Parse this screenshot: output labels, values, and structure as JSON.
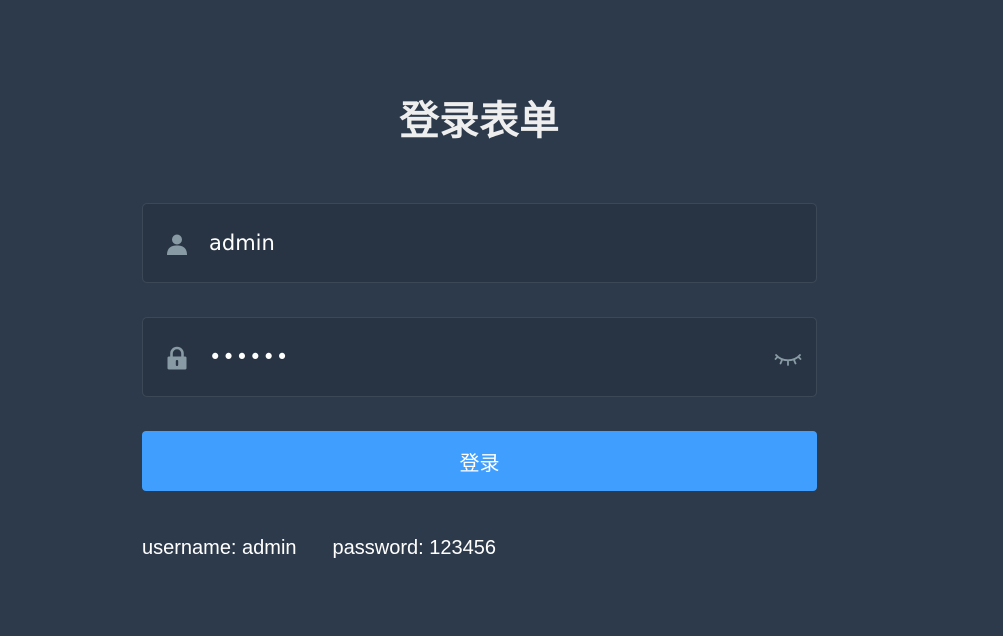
{
  "form": {
    "title": "登录表单",
    "username": {
      "value": "admin",
      "placeholder": "",
      "icon": "user-icon"
    },
    "password": {
      "value": "123456",
      "placeholder": "",
      "icon": "lock-icon",
      "toggle_icon": "eye-closed-icon"
    },
    "login_button_label": "登录"
  },
  "tips": {
    "username": "username: admin",
    "password": "password: 123456"
  },
  "colors": {
    "background": "#2d3a4b",
    "field_background": "#283443",
    "button": "#409eff",
    "icon": "#889aa4",
    "title": "#eeeeee"
  }
}
